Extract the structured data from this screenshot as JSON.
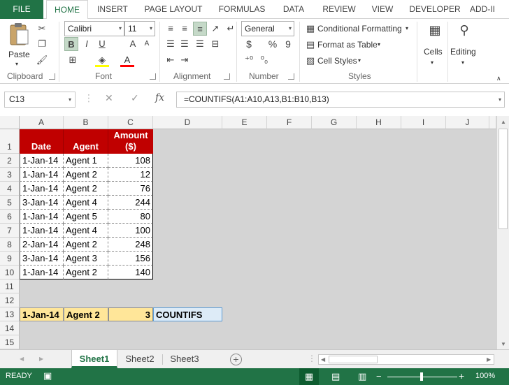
{
  "ribbon": {
    "tabs": [
      "FILE",
      "HOME",
      "INSERT",
      "PAGE LAYOUT",
      "FORMULAS",
      "DATA",
      "REVIEW",
      "VIEW",
      "DEVELOPER",
      "ADD-II"
    ],
    "active_tab": "HOME",
    "clipboard": {
      "paste_label": "Paste",
      "group_label": "Clipboard"
    },
    "font": {
      "family": "Calibri",
      "size": "11",
      "bold": "B",
      "italic": "I",
      "underline": "U",
      "grow": "A",
      "shrink": "A",
      "font_color_glyph": "A",
      "group_label": "Font"
    },
    "alignment": {
      "group_label": "Alignment"
    },
    "number": {
      "format": "General",
      "currency": "$",
      "percent": "%",
      "comma": "9",
      "group_label": "Number"
    },
    "styles": {
      "conditional": "Conditional Formatting",
      "format_table": "Format as Table",
      "cell_styles": "Cell Styles",
      "group_label": "Styles"
    },
    "cells_label": "Cells",
    "editing_label": "Editing"
  },
  "formula_bar": {
    "name_box": "C13",
    "fx": "fx",
    "formula": "=COUNTIFS(A1:A10,A13,B1:B10,B13)"
  },
  "columns": [
    "A",
    "B",
    "C",
    "D",
    "E",
    "F",
    "G",
    "H",
    "I",
    "J"
  ],
  "rows": [
    "1",
    "2",
    "3",
    "4",
    "5",
    "6",
    "7",
    "8",
    "9",
    "10",
    "11",
    "12",
    "13",
    "14",
    "15"
  ],
  "table": {
    "headers": [
      "Date",
      "Agent",
      "Amount ($)"
    ],
    "header_amount_line1": "Amount",
    "header_amount_line2": "($)",
    "rows": [
      [
        "1-Jan-14",
        "Agent 1",
        "108"
      ],
      [
        "1-Jan-14",
        "Agent 2",
        "12"
      ],
      [
        "1-Jan-14",
        "Agent 2",
        "76"
      ],
      [
        "3-Jan-14",
        "Agent 4",
        "244"
      ],
      [
        "1-Jan-14",
        "Agent 5",
        "80"
      ],
      [
        "1-Jan-14",
        "Agent 4",
        "100"
      ],
      [
        "2-Jan-14",
        "Agent 2",
        "248"
      ],
      [
        "3-Jan-14",
        "Agent 3",
        "156"
      ],
      [
        "1-Jan-14",
        "Agent 2",
        "140"
      ]
    ]
  },
  "criteria_row": {
    "date": "1-Jan-14",
    "agent": "Agent 2",
    "result": "3",
    "label": "COUNTIFS"
  },
  "sheets": [
    "Sheet1",
    "Sheet2",
    "Sheet3"
  ],
  "active_sheet": "Sheet1",
  "status": {
    "mode": "READY",
    "zoom": "100%"
  },
  "colors": {
    "excel_green": "#217346",
    "header_red": "#c00000",
    "criteria_yellow": "#ffe699",
    "label_blue": "#ddebf7"
  }
}
